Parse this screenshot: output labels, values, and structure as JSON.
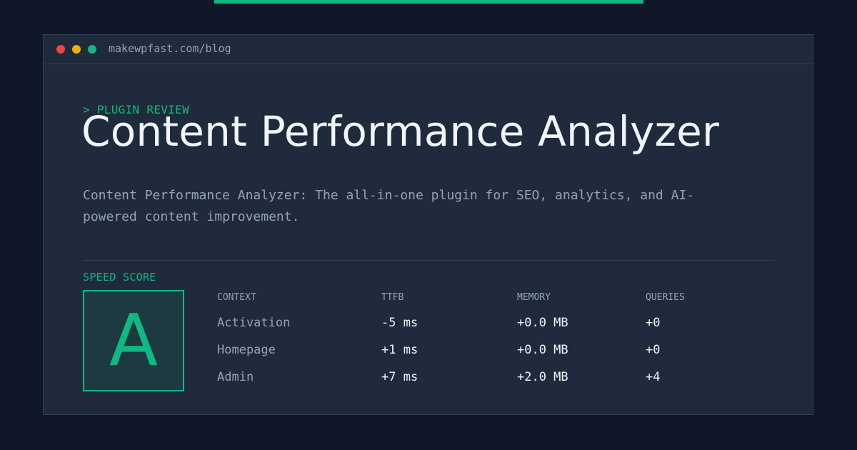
{
  "browser": {
    "url": "makewpfast.com/blog"
  },
  "article": {
    "kicker": "> PLUGIN REVIEW",
    "title": "Content Performance Analyzer",
    "description": "Content Performance Analyzer: The all-in-one plugin for SEO, analytics, and AI-powered content improvement."
  },
  "speed": {
    "label": "SPEED SCORE",
    "grade": "A"
  },
  "metrics": {
    "headers": [
      "CONTEXT",
      "TTFB",
      "MEMORY",
      "QUERIES"
    ],
    "rows": [
      {
        "context": "Activation",
        "ttfb": "-5 ms",
        "memory": "+0.0 MB",
        "queries": "+0"
      },
      {
        "context": "Homepage",
        "ttfb": "+1 ms",
        "memory": "+0.0 MB",
        "queries": "+0"
      },
      {
        "context": "Admin",
        "ttfb": "+7 ms",
        "memory": "+2.0 MB",
        "queries": "+4"
      }
    ]
  },
  "colors": {
    "accent": "#10b981",
    "background": "#0f1729",
    "panel": "#1f2a3c",
    "text": "#f1f5f9",
    "muted": "#94a3b8"
  }
}
